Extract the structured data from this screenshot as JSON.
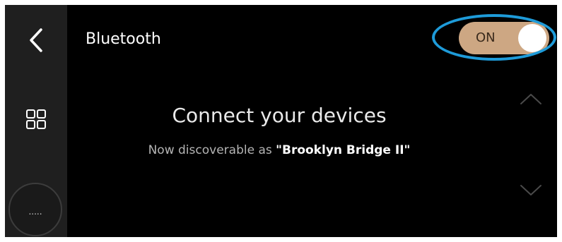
{
  "header": {
    "title": "Bluetooth",
    "toggle_label": "ON",
    "toggle_state": "on"
  },
  "sidebar": {
    "back_icon": "chevron-left-icon",
    "apps_icon": "grid-icon",
    "more_label": "....."
  },
  "main": {
    "heading": "Connect your devices",
    "discoverable_prefix": "Now discoverable as ",
    "device_name": "\"Brooklyn Bridge II\""
  },
  "scroll": {
    "up_icon": "chevron-up-icon",
    "down_icon": "chevron-down-icon"
  },
  "colors": {
    "background": "#000000",
    "sidebar": "#1f1f1f",
    "toggle_on": "#cda783",
    "highlight": "#1e9bd9"
  }
}
